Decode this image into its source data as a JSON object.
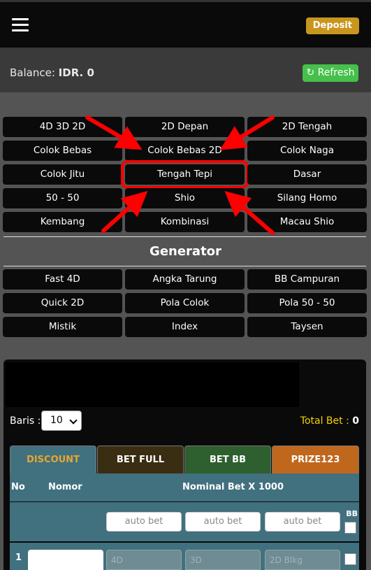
{
  "header": {
    "deposit_label": "Deposit"
  },
  "balance": {
    "label": "Balance:",
    "value": "IDR. 0",
    "refresh_label": "Refresh"
  },
  "game_types": [
    [
      "4D 3D 2D",
      "2D Depan",
      "2D Tengah"
    ],
    [
      "Colok Bebas",
      "Colok Bebas 2D",
      "Colok Naga"
    ],
    [
      "Colok Jitu",
      "Tengah Tepi",
      "Dasar"
    ],
    [
      "50 - 50",
      "Shio",
      "Silang Homo"
    ],
    [
      "Kembang",
      "Kombinasi",
      "Macau Shio"
    ]
  ],
  "generator": {
    "title": "Generator",
    "items": [
      [
        "Fast 4D",
        "Angka Tarung",
        "BB Campuran"
      ],
      [
        "Quick 2D",
        "Pola Colok",
        "Pola 50 - 50"
      ],
      [
        "Mistik",
        "Index",
        "Taysen"
      ]
    ]
  },
  "bet_panel": {
    "baris_label": "Baris :",
    "baris_value": "10",
    "total_bet_label": "Total Bet :",
    "total_bet_value": "0",
    "tabs": [
      {
        "label": "DISCOUNT",
        "bg": "#41707f",
        "color": "#e8a72e"
      },
      {
        "label": "BET FULL",
        "bg": "#3a2e12",
        "color": "#ffffff"
      },
      {
        "label": "BET BB",
        "bg": "#2e5f2e",
        "color": "#ffffff"
      },
      {
        "label": "PRIZE123",
        "bg": "#c0671e",
        "color": "#ffffff"
      }
    ],
    "headers": {
      "no": "No",
      "nomor": "Nomor",
      "nominal": "Nominal Bet X 1000",
      "bb": "BB"
    },
    "auto_bet_placeholder": "auto bet",
    "row": {
      "no": "1",
      "ph_4d": "4D",
      "ph_3d": "3D",
      "ph_2d": "2D Blkg"
    }
  },
  "colors": {
    "highlight": "#ff0000",
    "accent_gold": "#c8961e",
    "refresh_green": "#46c04a",
    "table_teal": "#41707f"
  }
}
